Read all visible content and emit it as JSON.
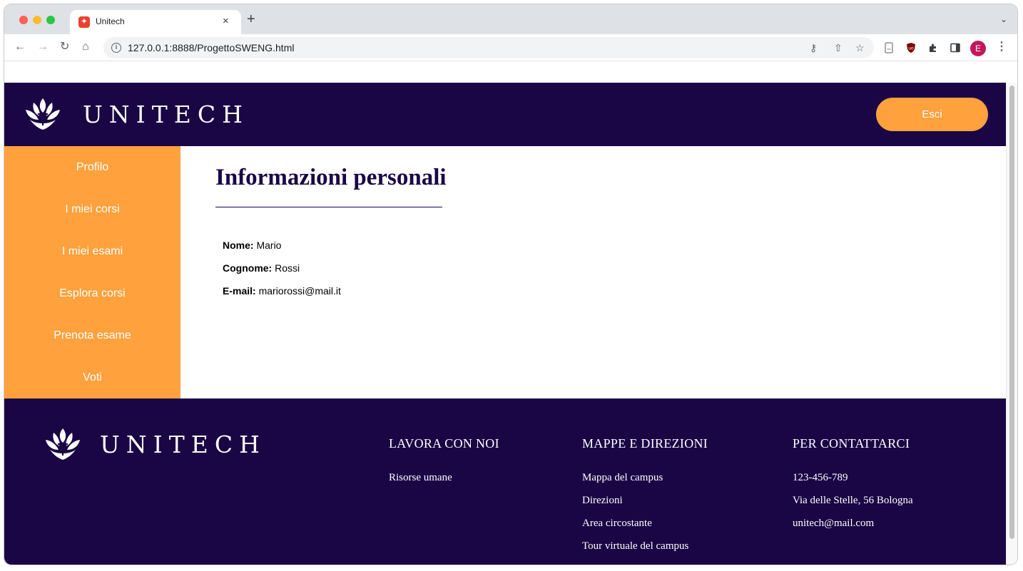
{
  "browser": {
    "tab_title": "Unitech",
    "tab_favicon": "unitech-favicon-icon",
    "new_tab_label": "+",
    "close_label": "×",
    "url": "127.0.0.1:8888/ProgettoSWENG.html",
    "avatar_letter": "E"
  },
  "header": {
    "brand": "UNITECH",
    "logout_label": "Esci"
  },
  "sidebar": {
    "items": [
      {
        "label": "Profilo"
      },
      {
        "label": "I miei corsi"
      },
      {
        "label": "I miei esami"
      },
      {
        "label": "Esplora corsi"
      },
      {
        "label": "Prenota esame"
      },
      {
        "label": "Voti"
      }
    ]
  },
  "main": {
    "title": "Informazioni personali",
    "fields": [
      {
        "label": "Nome:",
        "value": "Mario"
      },
      {
        "label": "Cognome:",
        "value": "Rossi"
      },
      {
        "label": "E-mail:",
        "value": "mariorossi@mail.it"
      }
    ]
  },
  "footer": {
    "brand": "UNITECH",
    "columns": [
      {
        "heading": "LAVORA CON NOI",
        "links": [
          "Risorse umane"
        ]
      },
      {
        "heading": "MAPPE E DIREZIONI",
        "links": [
          "Mappa del campus",
          "Direzioni",
          "Area circostante",
          "Tour virtuale del campus"
        ]
      },
      {
        "heading": "PER CONTATTARCI",
        "links": [
          "123-456-789",
          "Via delle Stelle, 56 Bologna",
          "unitech@mail.com"
        ]
      }
    ]
  },
  "colors": {
    "brand_navy": "#1a0545",
    "accent_orange": "#ffa13d"
  }
}
